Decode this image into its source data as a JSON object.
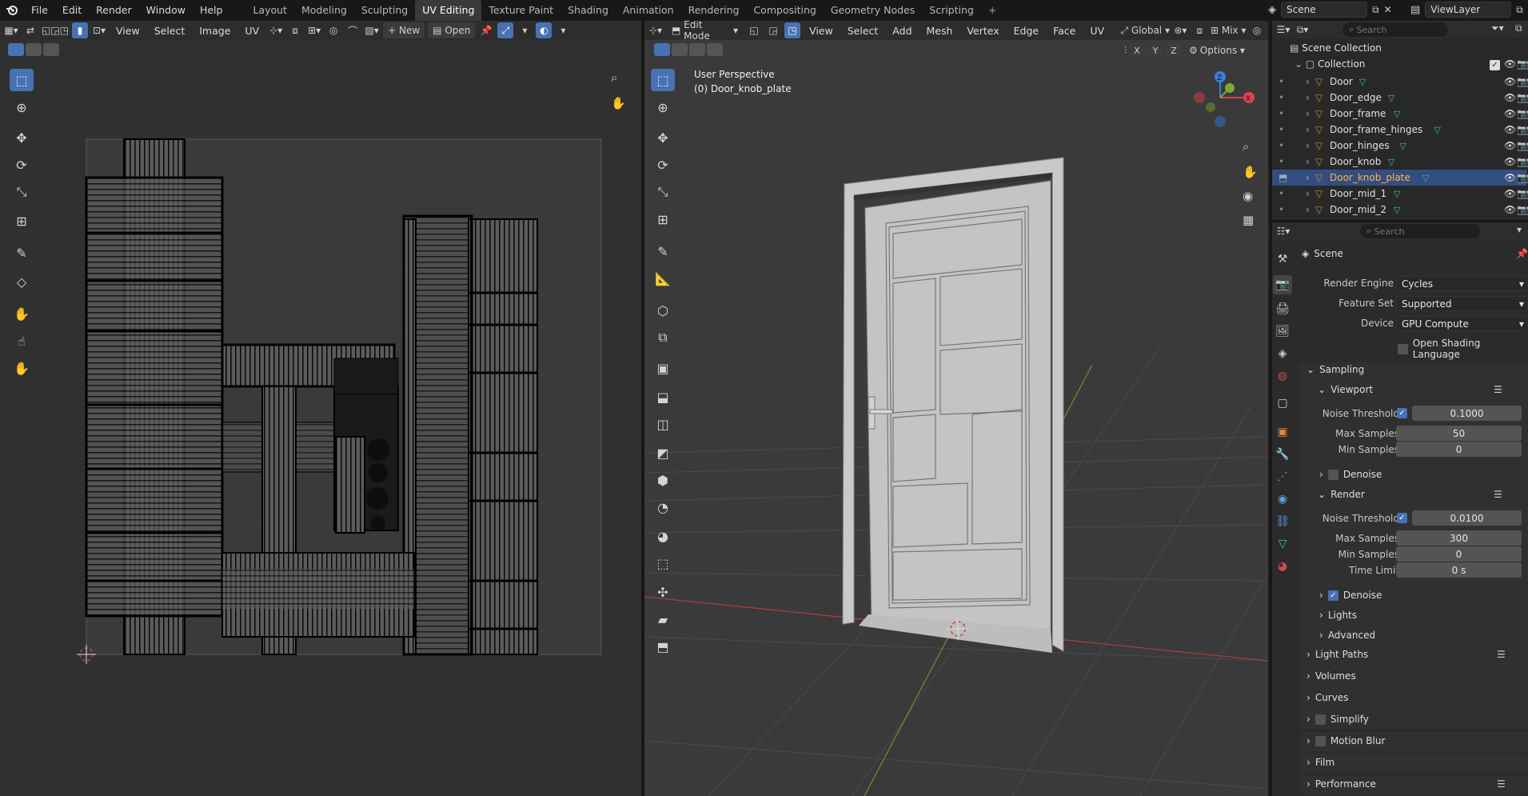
{
  "top_menu": [
    "File",
    "Edit",
    "Render",
    "Window",
    "Help"
  ],
  "workspace_tabs": [
    "Layout",
    "Modeling",
    "Sculpting",
    "UV Editing",
    "Texture Paint",
    "Shading",
    "Animation",
    "Rendering",
    "Compositing",
    "Geometry Nodes",
    "Scripting"
  ],
  "active_workspace": "UV Editing",
  "scene_name": "Scene",
  "view_layer": "ViewLayer",
  "uv_editor": {
    "menus": [
      "View",
      "Select",
      "Image",
      "UV"
    ],
    "new_label": "New",
    "open_label": "Open"
  },
  "viewport": {
    "mode": "Edit Mode",
    "menus": [
      "View",
      "Select",
      "Add",
      "Mesh",
      "Vertex",
      "Edge",
      "Face",
      "UV"
    ],
    "transform": "Global",
    "snap_mix": "Mix",
    "axes": [
      "X",
      "Y",
      "Z"
    ],
    "options_label": "Options",
    "view_name": "User Perspective",
    "object_name": "(0) Door_knob_plate",
    "gizmo": {
      "z": "Z",
      "x": "X"
    }
  },
  "outliner": {
    "search_placeholder": "Search",
    "root": "Scene Collection",
    "collection": "Collection",
    "items": [
      "Door",
      "Door_edge",
      "Door_frame",
      "Door_frame_hinges",
      "Door_hinges",
      "Door_knob",
      "Door_knob_plate",
      "Door_mid_1",
      "Door_mid_2"
    ],
    "selected": "Door_knob_plate"
  },
  "properties": {
    "search_placeholder": "Search",
    "scene_title": "Scene",
    "render_engine_label": "Render Engine",
    "render_engine": "Cycles",
    "feature_set_label": "Feature Set",
    "feature_set": "Supported",
    "device_label": "Device",
    "device": "GPU Compute",
    "osl_label": "Open Shading Language",
    "sampling": "Sampling",
    "viewport": "Viewport",
    "noise_threshold_label": "Noise Threshold",
    "vp_noise": "0.1000",
    "max_samples_label": "Max Samples",
    "vp_max": "50",
    "min_samples_label": "Min Samples",
    "vp_min": "0",
    "denoise_label": "Denoise",
    "render": "Render",
    "r_noise": "0.0100",
    "r_max": "300",
    "r_min": "0",
    "time_limit_label": "Time Limit",
    "r_time": "0 s",
    "lights": "Lights",
    "advanced": "Advanced",
    "sections": [
      "Light Paths",
      "Volumes",
      "Curves",
      "Simplify",
      "Motion Blur",
      "Film",
      "Performance"
    ]
  },
  "colors": {
    "accent": "#4772b3",
    "selected_row": "#334d80",
    "mesh_icon": "#3ec0a0",
    "object_icon": "#c98b3c",
    "x_axis": "#d94450",
    "y_axis": "#7fa83a",
    "z_axis": "#3a7fd9"
  }
}
